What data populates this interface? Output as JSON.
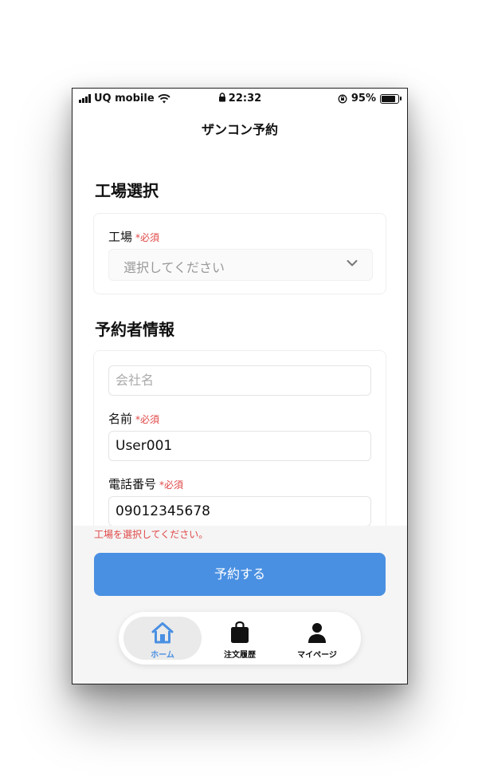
{
  "status_bar": {
    "carrier": "UQ mobile",
    "time": "22:32",
    "battery": "95%",
    "battery_level": 0.95
  },
  "nav": {
    "title": "ザンコン予約"
  },
  "factory_section": {
    "title": "工場選択",
    "field_label": "工場",
    "required_mark": "*必須",
    "select_placeholder": "選択してください"
  },
  "customer_section": {
    "title": "予約者情報",
    "company_placeholder": "会社名",
    "name_label": "名前",
    "name_required": "*必須",
    "name_value": "User001",
    "phone_label": "電話番号",
    "phone_required": "*必須",
    "phone_value": "09012345678"
  },
  "error_message": "工場を選択してください。",
  "submit_button": "予約する",
  "tabs": [
    {
      "label": "ホーム",
      "icon": "home-icon",
      "active": true
    },
    {
      "label": "注文履歴",
      "icon": "bag-icon",
      "active": false
    },
    {
      "label": "マイページ",
      "icon": "person-icon",
      "active": false
    }
  ],
  "colors": {
    "accent": "#4a90e2",
    "error": "#e04646"
  }
}
